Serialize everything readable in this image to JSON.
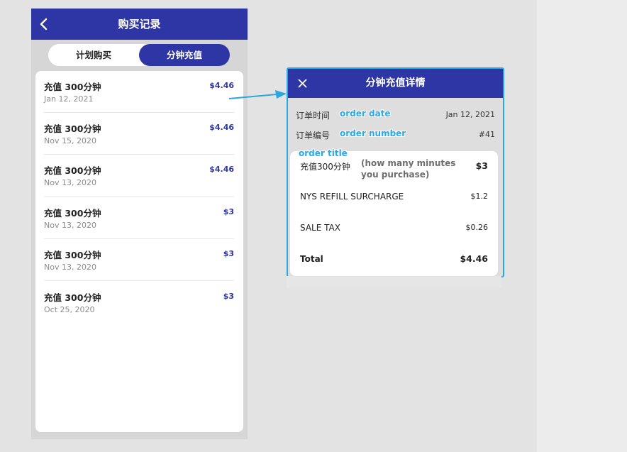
{
  "purchase_screen": {
    "title": "购买记录",
    "tabs": [
      {
        "label": "计划购买",
        "active": false
      },
      {
        "label": "分钟充值",
        "active": true
      }
    ],
    "orders": [
      {
        "title": "充值 300分钟",
        "date": "Jan 12, 2021",
        "amount": "$4.46"
      },
      {
        "title": "充值 300分钟",
        "date": "Nov 15, 2020",
        "amount": "$4.46"
      },
      {
        "title": "充值 300分钟",
        "date": "Nov 13, 2020",
        "amount": "$4.46"
      },
      {
        "title": "充值 300分钟",
        "date": "Nov 13, 2020",
        "amount": "$3"
      },
      {
        "title": "充值 300分钟",
        "date": "Nov 13, 2020",
        "amount": "$3"
      },
      {
        "title": "充值 300分钟",
        "date": "Oct 25, 2020",
        "amount": "$3"
      }
    ]
  },
  "detail_panel": {
    "title": "分钟充值详情",
    "order_date_label": "订单时间",
    "order_date": "Jan 12, 2021",
    "order_number_label": "订单编号",
    "order_number": "#41",
    "items": [
      {
        "label": "充值300分钟",
        "value": "$3"
      },
      {
        "label": "NYS REFILL SURCHARGE",
        "value": "$1.2"
      },
      {
        "label": "SALE TAX",
        "value": "$0.26"
      }
    ],
    "total_label": "Total",
    "total_value": "$4.46"
  },
  "annotations": {
    "order_date": "order date",
    "order_number": "order number",
    "order_title": "order title",
    "minutes_note_line1": "(how many minutes",
    "minutes_note_line2": "you purchase)"
  },
  "colors": {
    "primary": "#2e36a6",
    "annotation_blue": "#29a8e8",
    "panel_border": "#2aa7e0"
  },
  "icons": {
    "back": "chevron-left-icon",
    "close": "close-icon",
    "arrow": "arrow-right-icon"
  }
}
